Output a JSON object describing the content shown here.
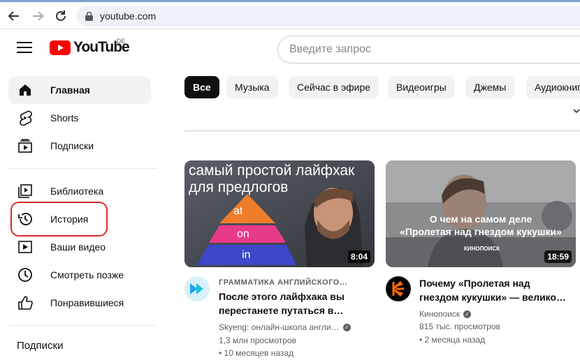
{
  "browser": {
    "url": "youtube.com"
  },
  "masthead": {
    "logo_text": "YouTube",
    "country_code": "DE",
    "search_placeholder": "Введите запрос"
  },
  "sidebar": {
    "items": [
      {
        "label": "Главная",
        "icon": "home-icon",
        "active": true
      },
      {
        "label": "Shorts",
        "icon": "shorts-icon"
      },
      {
        "label": "Подписки",
        "icon": "subscriptions-icon"
      },
      {
        "label": "Библиотека",
        "icon": "library-icon"
      },
      {
        "label": "История",
        "icon": "history-icon",
        "highlighted": true
      },
      {
        "label": "Ваши видео",
        "icon": "your-videos-icon"
      },
      {
        "label": "Смотреть позже",
        "icon": "watch-later-icon"
      },
      {
        "label": "Понравившиеся",
        "icon": "liked-icon"
      }
    ],
    "section_heading": "Подписки"
  },
  "chips": [
    "Все",
    "Музыка",
    "Сейчас в эфире",
    "Видеоигры",
    "Джемы",
    "Аудиокниги"
  ],
  "videos": [
    {
      "thumb_text_top": "самый простой лайфхак",
      "thumb_text_bottom": "для предлогов",
      "pyramid": [
        "at",
        "on",
        "in"
      ],
      "duration": "8:04",
      "channel_label": "ГРАММАТИКА АНГЛИЙСКОГО…",
      "title_line1": "После этого лайфхака вы",
      "title_line2": "перестанете путаться в…",
      "channel": "Skyeng: онлайн-школа англи…",
      "views": "1,3 млн просмотров",
      "age": "• 10 месяцев назад"
    },
    {
      "thumb_line1": "О чем на самом деле",
      "thumb_line2": "«Пролетая над гнездом кукушки»",
      "thumb_brand": "КИНОПОИСК",
      "duration": "18:59",
      "title_line1": "Почему «Пролетая над",
      "title_line2": "гнездом кукушки» — велико…",
      "channel": "Кинопоиск",
      "views": "815 тыс. просмотров",
      "age": "• 2 месяца назад"
    }
  ],
  "colors": {
    "brand_red": "#ff0000",
    "highlight_red": "#d82a2a",
    "chip_selected": "#0f0f0f"
  }
}
